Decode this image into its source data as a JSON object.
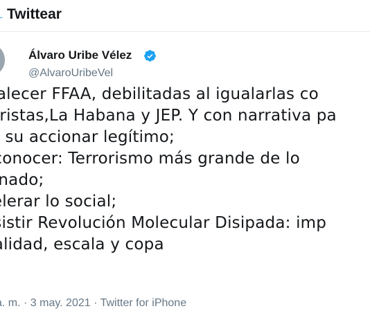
{
  "header": {
    "title": "Twittear"
  },
  "author": {
    "name": "Álvaro Uribe Vélez",
    "handle": "@AlvaroUribeVel",
    "verified": true
  },
  "tweet": {
    "lines": [
      "rtalecer FFAA, debilitadas al igualarlas co",
      "roristas,La Habana y JEP. Y con narrativa pa",
      "ar su accionar legítimo;",
      "econocer: Terrorismo más grande de lo",
      "ginado;",
      "celerar lo social;",
      "esistir Revolución Molecular Disipada: imp",
      "nalidad, escala y copa"
    ]
  },
  "meta": {
    "time": "a. m.",
    "separator": " · ",
    "date": "3 may. 2021",
    "source": "Twitter for iPhone"
  },
  "colors": {
    "accent": "#1da1f2",
    "text": "#14171a",
    "muted": "#657786"
  }
}
